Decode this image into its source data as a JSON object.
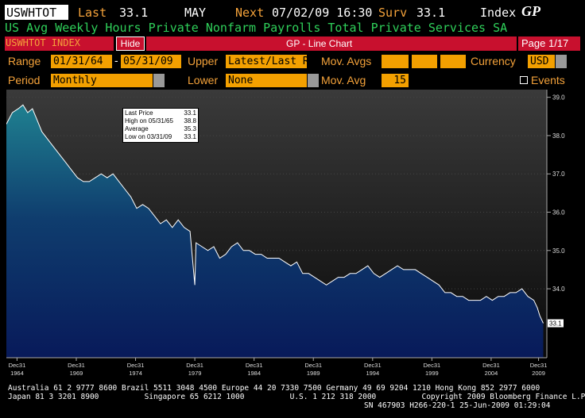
{
  "header": {
    "ticker": "USWHTOT",
    "last_label": "Last",
    "last_value": "33.1",
    "month": "MAY",
    "next_label": "Next",
    "next_value": "07/02/09 16:30",
    "surv_label": "Surv",
    "surv_value": "33.1",
    "index_label": "Index",
    "gp_logo": "GP",
    "description": "US Avg Weekly Hours Private Nonfarm Payrolls Total Private Services SA"
  },
  "titlebar": {
    "security": "USWHTOT INDEX",
    "hide_label": "Hide",
    "chart_title": "GP - Line Chart",
    "page": "Page 1/17"
  },
  "controls": {
    "range_label": "Range",
    "range_start": "01/31/64",
    "range_sep": "-",
    "range_end": "05/31/09",
    "upper_label": "Upper",
    "upper_value": "Latest/Last Re",
    "mov_avgs_label": "Mov. Avgs",
    "currency_label": "Currency",
    "currency_value": "USD",
    "period_label": "Period",
    "period_value": "Monthly",
    "lower_label": "Lower",
    "lower_value": "None",
    "mov_avg_label": "Mov. Avg",
    "mov_avg_value": "15",
    "events_label": "Events"
  },
  "legend_box": {
    "rows": [
      {
        "label": "Last Price",
        "value": "33.1"
      },
      {
        "label": "High on 05/31/65",
        "value": "38.8"
      },
      {
        "label": "Average",
        "value": "35.3"
      },
      {
        "label": "Low on 03/31/09",
        "value": "33.1"
      }
    ]
  },
  "chart_data": {
    "type": "area",
    "x_ticks": [
      {
        "top": "Dec31",
        "bottom": "1964",
        "year": 1964.9
      },
      {
        "top": "Dec31",
        "bottom": "1969",
        "year": 1969.9
      },
      {
        "top": "Dec31",
        "bottom": "1974",
        "year": 1974.9
      },
      {
        "top": "Dec31",
        "bottom": "1979",
        "year": 1979.9
      },
      {
        "top": "Dec31",
        "bottom": "1984",
        "year": 1984.9
      },
      {
        "top": "Dec31",
        "bottom": "1989",
        "year": 1989.9
      },
      {
        "top": "Dec31",
        "bottom": "1994",
        "year": 1994.9
      },
      {
        "top": "Dec31",
        "bottom": "1999",
        "year": 1999.9
      },
      {
        "top": "Dec31",
        "bottom": "2004",
        "year": 2004.9
      },
      {
        "top": "Dec31",
        "bottom": "2009",
        "year": 2008.9
      }
    ],
    "y_ticks": [
      "39.0",
      "38.0",
      "37.0",
      "36.0",
      "35.0",
      "34.0"
    ],
    "y_tick_values": [
      39,
      38,
      37,
      36,
      35,
      34
    ],
    "ylim": [
      32.2,
      39.2
    ],
    "xlim": [
      1964.0,
      2009.6
    ],
    "last_label": "33.1",
    "line_color": "#ffffff",
    "points": [
      [
        1964.0,
        38.3
      ],
      [
        1964.5,
        38.6
      ],
      [
        1965.0,
        38.7
      ],
      [
        1965.4,
        38.8
      ],
      [
        1965.8,
        38.6
      ],
      [
        1966.2,
        38.7
      ],
      [
        1966.6,
        38.4
      ],
      [
        1967.0,
        38.1
      ],
      [
        1967.5,
        37.9
      ],
      [
        1968.0,
        37.7
      ],
      [
        1968.5,
        37.5
      ],
      [
        1969.0,
        37.3
      ],
      [
        1969.5,
        37.1
      ],
      [
        1970.0,
        36.9
      ],
      [
        1970.5,
        36.8
      ],
      [
        1971.0,
        36.8
      ],
      [
        1971.5,
        36.9
      ],
      [
        1972.0,
        37.0
      ],
      [
        1972.5,
        36.9
      ],
      [
        1973.0,
        37.0
      ],
      [
        1973.5,
        36.8
      ],
      [
        1974.0,
        36.6
      ],
      [
        1974.5,
        36.4
      ],
      [
        1975.0,
        36.1
      ],
      [
        1975.5,
        36.2
      ],
      [
        1976.0,
        36.1
      ],
      [
        1976.5,
        35.9
      ],
      [
        1977.0,
        35.7
      ],
      [
        1977.5,
        35.8
      ],
      [
        1978.0,
        35.6
      ],
      [
        1978.5,
        35.8
      ],
      [
        1979.0,
        35.6
      ],
      [
        1979.5,
        35.5
      ],
      [
        1979.9,
        34.1
      ],
      [
        1980.0,
        35.2
      ],
      [
        1980.5,
        35.1
      ],
      [
        1981.0,
        35.0
      ],
      [
        1981.5,
        35.1
      ],
      [
        1982.0,
        34.8
      ],
      [
        1982.5,
        34.9
      ],
      [
        1983.0,
        35.1
      ],
      [
        1983.5,
        35.2
      ],
      [
        1984.0,
        35.0
      ],
      [
        1984.5,
        35.0
      ],
      [
        1985.0,
        34.9
      ],
      [
        1985.5,
        34.9
      ],
      [
        1986.0,
        34.8
      ],
      [
        1986.5,
        34.8
      ],
      [
        1987.0,
        34.8
      ],
      [
        1987.5,
        34.7
      ],
      [
        1988.0,
        34.6
      ],
      [
        1988.5,
        34.7
      ],
      [
        1989.0,
        34.4
      ],
      [
        1989.5,
        34.4
      ],
      [
        1990.0,
        34.3
      ],
      [
        1990.5,
        34.2
      ],
      [
        1991.0,
        34.1
      ],
      [
        1991.5,
        34.2
      ],
      [
        1992.0,
        34.3
      ],
      [
        1992.5,
        34.3
      ],
      [
        1993.0,
        34.4
      ],
      [
        1993.5,
        34.4
      ],
      [
        1994.0,
        34.5
      ],
      [
        1994.5,
        34.6
      ],
      [
        1995.0,
        34.4
      ],
      [
        1995.5,
        34.3
      ],
      [
        1996.0,
        34.4
      ],
      [
        1996.5,
        34.5
      ],
      [
        1997.0,
        34.6
      ],
      [
        1997.5,
        34.5
      ],
      [
        1998.0,
        34.5
      ],
      [
        1998.5,
        34.5
      ],
      [
        1999.0,
        34.4
      ],
      [
        1999.5,
        34.3
      ],
      [
        2000.0,
        34.2
      ],
      [
        2000.5,
        34.1
      ],
      [
        2001.0,
        33.9
      ],
      [
        2001.5,
        33.9
      ],
      [
        2002.0,
        33.8
      ],
      [
        2002.5,
        33.8
      ],
      [
        2003.0,
        33.7
      ],
      [
        2003.5,
        33.7
      ],
      [
        2004.0,
        33.7
      ],
      [
        2004.5,
        33.8
      ],
      [
        2005.0,
        33.7
      ],
      [
        2005.5,
        33.8
      ],
      [
        2006.0,
        33.8
      ],
      [
        2006.5,
        33.9
      ],
      [
        2007.0,
        33.9
      ],
      [
        2007.5,
        34.0
      ],
      [
        2008.0,
        33.8
      ],
      [
        2008.5,
        33.7
      ],
      [
        2008.8,
        33.5
      ],
      [
        2009.0,
        33.3
      ],
      [
        2009.3,
        33.1
      ]
    ]
  },
  "footer": {
    "line1": "Australia 61 2 9777 8600 Brazil 5511 3048 4500 Europe 44 20 7330 7500 Germany 49 69 9204 1210 Hong Kong 852 2977 6000",
    "line2": "Japan 81 3 3201 8900          Singapore 65 6212 1000          U.S. 1 212 318 2000          Copyright 2009 Bloomberg Finance L.P.",
    "line3": "SN 467903 H266-220-1 25-Jun-2009 01:29:04"
  }
}
